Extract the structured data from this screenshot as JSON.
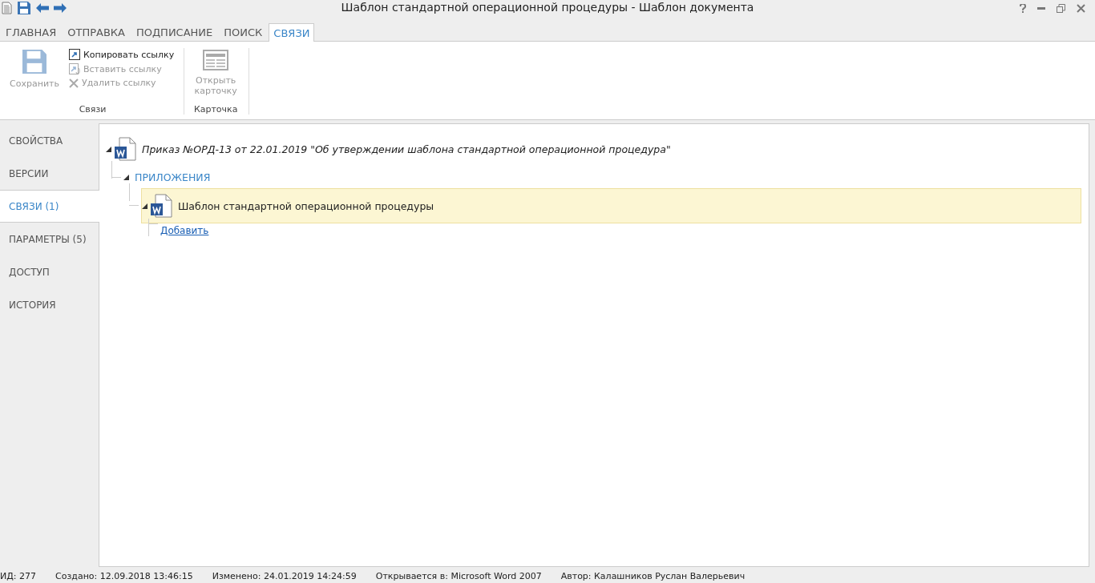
{
  "window": {
    "title": "Шаблон стандартной операционной процедуры - Шаблон документа"
  },
  "ribbon_tabs": [
    {
      "label": "ГЛАВНАЯ",
      "selected": false
    },
    {
      "label": "ОТПРАВКА",
      "selected": false
    },
    {
      "label": "ПОДПИСАНИЕ",
      "selected": false
    },
    {
      "label": "ПОИСК",
      "selected": false
    },
    {
      "label": "СВЯЗИ",
      "selected": true
    }
  ],
  "ribbon_groups": [
    {
      "label": "Связи",
      "items": [
        {
          "kind": "large",
          "label": "Сохранить",
          "disabled": true
        },
        {
          "kind": "small",
          "label": "Копировать ссылку",
          "disabled": false
        },
        {
          "kind": "small",
          "label": "Вставить ссылку",
          "disabled": true
        },
        {
          "kind": "small",
          "label": "Удалить ссылку",
          "disabled": true
        }
      ]
    },
    {
      "label": "Карточка",
      "items": [
        {
          "kind": "large",
          "label": "Открыть карточку",
          "disabled": true
        }
      ]
    }
  ],
  "sidebar": {
    "items": [
      {
        "label": "СВОЙСТВА",
        "selected": false
      },
      {
        "label": "ВЕРСИИ",
        "selected": false
      },
      {
        "label": "СВЯЗИ (1)",
        "selected": true
      },
      {
        "label": "ПАРАМЕТРЫ (5)",
        "selected": false
      },
      {
        "label": "ДОСТУП",
        "selected": false
      },
      {
        "label": "ИСТОРИЯ",
        "selected": false
      }
    ]
  },
  "tree": {
    "kind": "document",
    "label": "Приказ №ОРД-13 от 22.01.2019 \"Об утверждении шаблона стандартной операционной процедура\"",
    "expanded": true,
    "selected": false,
    "children": [
      {
        "kind": "group",
        "label": "ПРИЛОЖЕНИЯ",
        "expanded": true,
        "children": [
          {
            "kind": "document",
            "label": "Шаблон стандартной операционной процедуры",
            "expanded": true,
            "selected": true
          }
        ]
      }
    ]
  },
  "add_link": "Добавить",
  "status_bar": [
    "ИД: 277",
    "Создано: 12.09.2018 13:46:15",
    "Изменено: 24.01.2019 14:24:59",
    "Открывается в: Microsoft Word 2007",
    "Автор: Калашников Руслан Валерьевич"
  ]
}
